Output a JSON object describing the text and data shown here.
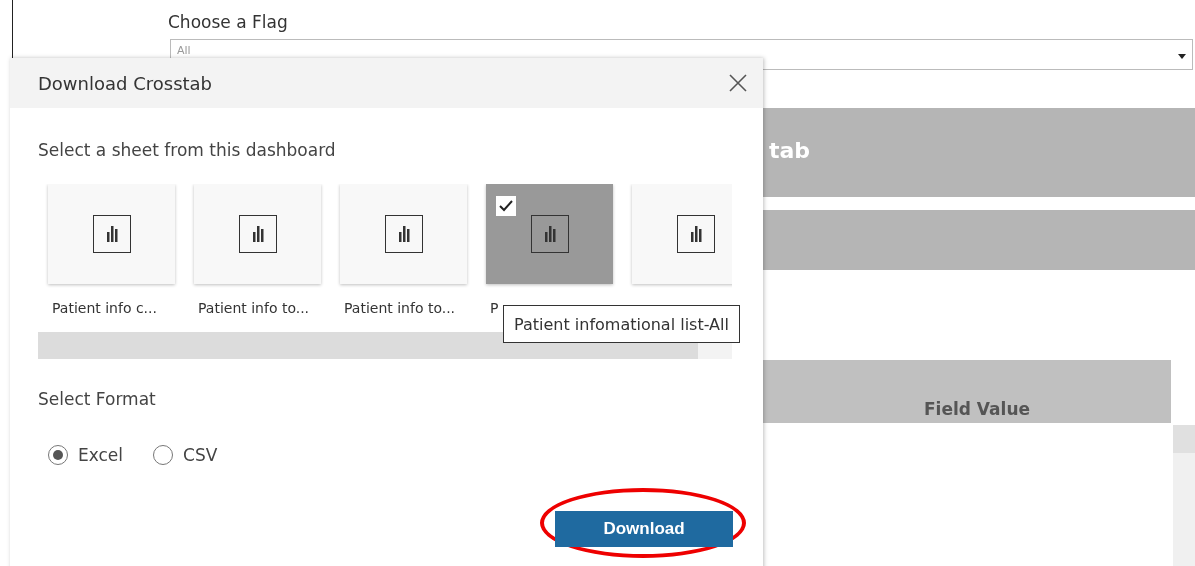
{
  "background": {
    "filter": {
      "label": "Choose a Flag",
      "value": "All"
    },
    "banner_text": "tab",
    "table": {
      "columns": [
        "Field Value"
      ]
    }
  },
  "dialog": {
    "title": "Download Crosstab",
    "sheet_prompt": "Select a sheet from this dashboard",
    "sheets": [
      {
        "label": "Patient info c...",
        "selected": false
      },
      {
        "label": "Patient info to...",
        "selected": false
      },
      {
        "label": "Patient info to...",
        "selected": false
      },
      {
        "label": "P",
        "selected": true
      },
      {
        "selected": false
      }
    ],
    "tooltip": "Patient infomational list-All",
    "format_prompt": "Select Format",
    "formats": [
      {
        "label": "Excel",
        "selected": true
      },
      {
        "label": "CSV",
        "selected": false
      }
    ],
    "download_button": "Download"
  }
}
